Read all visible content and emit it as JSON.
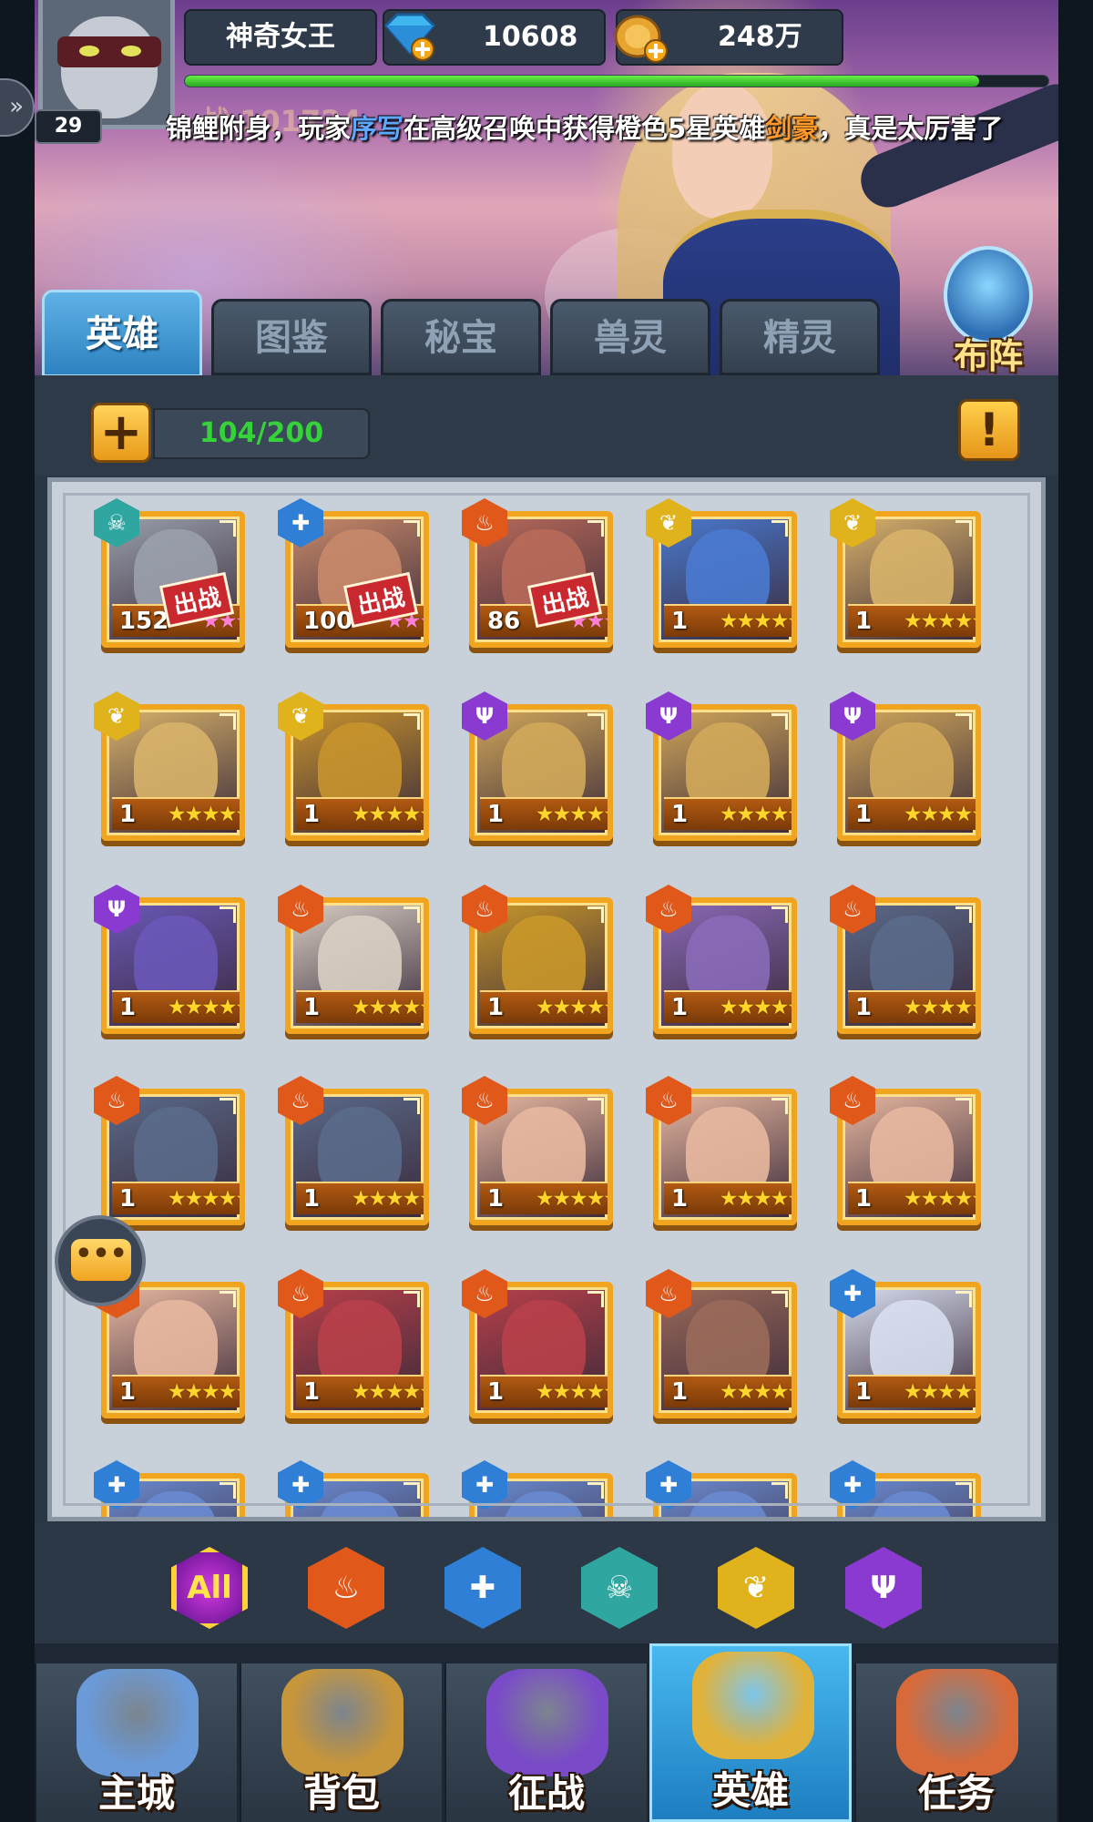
{
  "player": {
    "name": "神奇女王",
    "level": "29",
    "exp_fraction": 0.92,
    "power": "战 101724"
  },
  "currency": {
    "diamonds": "10608",
    "gold": "248万"
  },
  "broadcast": {
    "prefix": "锦鲤附身，玩家",
    "player": "序写",
    "middle": "在高级召唤中获得橙色5星英雄",
    "hero": "剑豪",
    "suffix": "，真是太厉害了"
  },
  "tabs": [
    "英雄",
    "图鉴",
    "秘宝",
    "兽灵",
    "精灵"
  ],
  "formation_label": "布阵",
  "hero_count": "104/200",
  "info_icon": "!",
  "deploy_label": "出战",
  "factions": {
    "death": {
      "icon": "skull-icon",
      "color": "#2fa6a0"
    },
    "holy": {
      "icon": "cross-icon",
      "color": "#2f7fd6"
    },
    "fire": {
      "icon": "flame-icon",
      "color": "#e0581a"
    },
    "nature": {
      "icon": "leaf-icon",
      "color": "#e0b21c"
    },
    "shadow": {
      "icon": "trident-icon",
      "color": "#8a3ad0"
    }
  },
  "heroes": [
    {
      "level": "152",
      "stars": "★★★",
      "star_color": "pink",
      "faction": "death",
      "deployed": true,
      "tint": "#9aa0ac"
    },
    {
      "level": "100",
      "stars": "★★★",
      "star_color": "pink",
      "faction": "holy",
      "deployed": true,
      "tint": "#c98a6a"
    },
    {
      "level": "86",
      "stars": "★★★",
      "star_color": "pink",
      "faction": "fire",
      "deployed": true,
      "tint": "#b86a5a"
    },
    {
      "level": "1",
      "stars": "★★★★★",
      "star_color": "gold",
      "faction": "nature",
      "deployed": false,
      "tint": "#4a7ad0"
    },
    {
      "level": "1",
      "stars": "★★★★★",
      "star_color": "gold",
      "faction": "nature",
      "deployed": false,
      "tint": "#d8b26a"
    },
    {
      "level": "1",
      "stars": "★★★★★",
      "star_color": "gold",
      "faction": "nature",
      "deployed": false,
      "tint": "#d8b26a"
    },
    {
      "level": "1",
      "stars": "★★★★★",
      "star_color": "gold",
      "faction": "nature",
      "deployed": false,
      "tint": "#c8942e"
    },
    {
      "level": "1",
      "stars": "★★★★★",
      "star_color": "gold",
      "faction": "shadow",
      "deployed": false,
      "tint": "#d2a85a"
    },
    {
      "level": "1",
      "stars": "★★★★★",
      "star_color": "gold",
      "faction": "shadow",
      "deployed": false,
      "tint": "#d2a85a"
    },
    {
      "level": "1",
      "stars": "★★★★★",
      "star_color": "gold",
      "faction": "shadow",
      "deployed": false,
      "tint": "#d2a85a"
    },
    {
      "level": "1",
      "stars": "★★★★★",
      "star_color": "gold",
      "faction": "shadow",
      "deployed": false,
      "tint": "#6a58b8"
    },
    {
      "level": "1",
      "stars": "★★★★★",
      "star_color": "gold",
      "faction": "fire",
      "deployed": false,
      "tint": "#d8cfc4"
    },
    {
      "level": "1",
      "stars": "★★★★★",
      "star_color": "gold",
      "faction": "fire",
      "deployed": false,
      "tint": "#c9982a"
    },
    {
      "level": "1",
      "stars": "★★★★★",
      "star_color": "gold",
      "faction": "fire",
      "deployed": false,
      "tint": "#8a6ab8"
    },
    {
      "level": "1",
      "stars": "★★★★★",
      "star_color": "gold",
      "faction": "fire",
      "deployed": false,
      "tint": "#5a6a8a"
    },
    {
      "level": "1",
      "stars": "★★★★★",
      "star_color": "gold",
      "faction": "fire",
      "deployed": false,
      "tint": "#5a6a8a"
    },
    {
      "level": "1",
      "stars": "★★★★★",
      "star_color": "gold",
      "faction": "fire",
      "deployed": false,
      "tint": "#5a6a8a"
    },
    {
      "level": "1",
      "stars": "★★★★★",
      "star_color": "gold",
      "faction": "fire",
      "deployed": false,
      "tint": "#e8b8a0"
    },
    {
      "level": "1",
      "stars": "★★★★★",
      "star_color": "gold",
      "faction": "fire",
      "deployed": false,
      "tint": "#e8b8a0"
    },
    {
      "level": "1",
      "stars": "★★★★★",
      "star_color": "gold",
      "faction": "fire",
      "deployed": false,
      "tint": "#e8b8a0"
    },
    {
      "level": "1",
      "stars": "★★★★★",
      "star_color": "gold",
      "faction": "fire",
      "deployed": false,
      "tint": "#e8b8a0"
    },
    {
      "level": "1",
      "stars": "★★★★★",
      "star_color": "gold",
      "faction": "fire",
      "deployed": false,
      "tint": "#b8404a"
    },
    {
      "level": "1",
      "stars": "★★★★★",
      "star_color": "gold",
      "faction": "fire",
      "deployed": false,
      "tint": "#b8404a"
    },
    {
      "level": "1",
      "stars": "★★★★★",
      "star_color": "gold",
      "faction": "fire",
      "deployed": false,
      "tint": "#9a6a5a"
    },
    {
      "level": "1",
      "stars": "★★★★★",
      "star_color": "gold",
      "faction": "holy",
      "deployed": false,
      "tint": "#d8dff0"
    },
    {
      "level": "",
      "stars": "",
      "star_color": "gold",
      "faction": "holy",
      "deployed": false,
      "tint": "#6a8ad0"
    },
    {
      "level": "",
      "stars": "",
      "star_color": "gold",
      "faction": "holy",
      "deployed": false,
      "tint": "#6a8ad0"
    },
    {
      "level": "",
      "stars": "",
      "star_color": "gold",
      "faction": "holy",
      "deployed": false,
      "tint": "#6a8ad0"
    },
    {
      "level": "",
      "stars": "",
      "star_color": "gold",
      "faction": "holy",
      "deployed": false,
      "tint": "#6a8ad0"
    },
    {
      "level": "",
      "stars": "",
      "star_color": "gold",
      "faction": "holy",
      "deployed": false,
      "tint": "#6a8ad0"
    }
  ],
  "filters": [
    {
      "label": "All",
      "faction": "all"
    },
    {
      "label": "",
      "faction": "fire"
    },
    {
      "label": "",
      "faction": "holy"
    },
    {
      "label": "",
      "faction": "death"
    },
    {
      "label": "",
      "faction": "nature"
    },
    {
      "label": "",
      "faction": "shadow"
    }
  ],
  "bottom_nav": [
    {
      "label": "主城",
      "icon": "castle-icon",
      "tint": "#6a9ad8"
    },
    {
      "label": "背包",
      "icon": "treasure-chest-icon",
      "tint": "#c8963a"
    },
    {
      "label": "征战",
      "icon": "dragon-portal-icon",
      "tint": "#7a4ac8"
    },
    {
      "label": "英雄",
      "icon": "hero-helmet-icon",
      "tint": "#e0b23a",
      "active": true
    },
    {
      "label": "任务",
      "icon": "scroll-icon",
      "tint": "#d86a3a"
    }
  ]
}
